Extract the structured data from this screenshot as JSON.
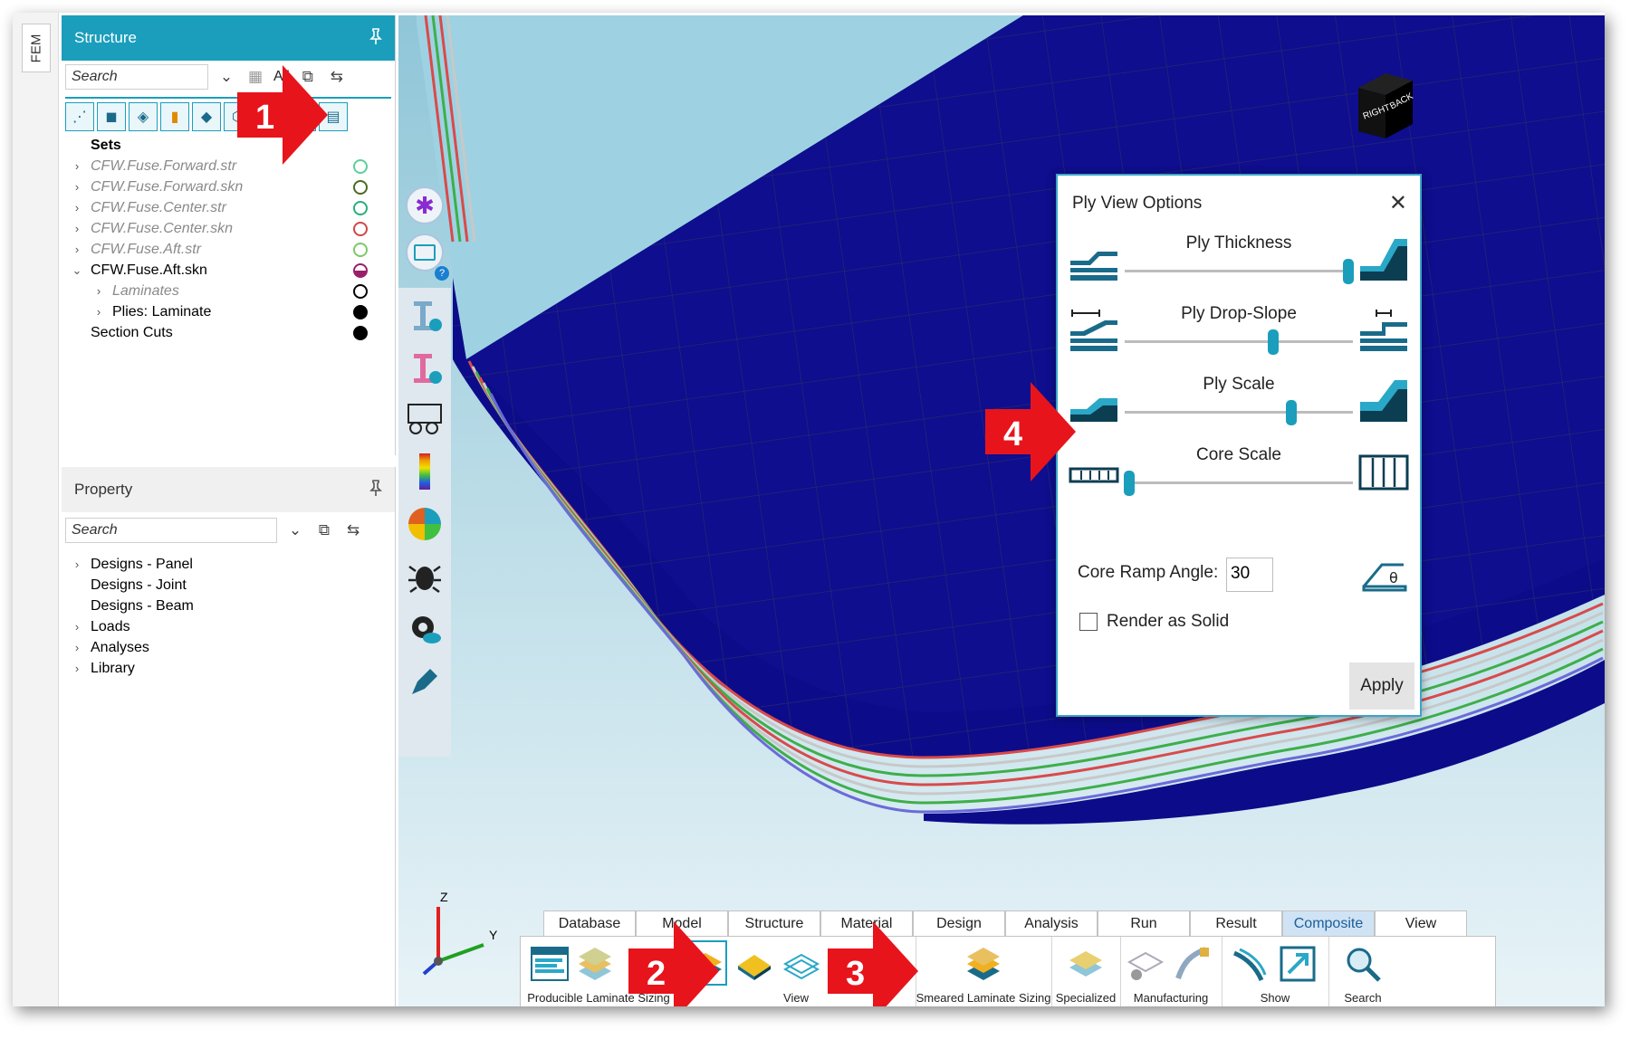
{
  "side_tab": {
    "label": "FEM"
  },
  "structure_panel": {
    "title": "Structure",
    "search_placeholder": "Search",
    "all_label": "All",
    "tree": [
      {
        "label": "Sets",
        "style": "bold",
        "circle": ""
      },
      {
        "label": "CFW.Fuse.Forward.str",
        "style": "dim",
        "circle": "#5ccf9a"
      },
      {
        "label": "CFW.Fuse.Forward.skn",
        "style": "dim",
        "circle": "#4a6b1f"
      },
      {
        "label": "CFW.Fuse.Center.str",
        "style": "dim",
        "circle": "#27b07a"
      },
      {
        "label": "CFW.Fuse.Center.skn",
        "style": "dim",
        "circle": "#d04848"
      },
      {
        "label": "CFW.Fuse.Aft.str",
        "style": "dim",
        "circle": "#7cc968"
      },
      {
        "label": "CFW.Fuse.Aft.skn",
        "style": "normal",
        "circle": "#9a1f6b"
      },
      {
        "label": "Laminates",
        "style": "dim-child",
        "circle": "#000000"
      },
      {
        "label": "Plies: Laminate",
        "style": "child",
        "circle": "#000000"
      },
      {
        "label": "Section Cuts",
        "style": "normal",
        "circle": "#000000"
      }
    ]
  },
  "property_panel": {
    "title": "Property",
    "search_placeholder": "Search",
    "tree": [
      {
        "label": "Designs - Panel",
        "caret": true
      },
      {
        "label": "Designs - Joint",
        "caret": false
      },
      {
        "label": "Designs - Beam",
        "caret": false
      },
      {
        "label": "Loads",
        "caret": true
      },
      {
        "label": "Analyses",
        "caret": true
      },
      {
        "label": "Library",
        "caret": true
      }
    ]
  },
  "viewcube": {
    "right": "RIGHT",
    "back": "BACK"
  },
  "dialog": {
    "title": "Ply View Options",
    "sliders": [
      {
        "label": "Ply Thickness",
        "value": 0.98
      },
      {
        "label": "Ply Drop-Slope",
        "value": 0.65
      },
      {
        "label": "Ply Scale",
        "value": 0.73
      },
      {
        "label": "Core Scale",
        "value": 0.02
      }
    ],
    "core_ramp_label": "Core Ramp Angle:",
    "core_ramp_value": "30",
    "render_solid_label": "Render as Solid",
    "render_solid_checked": false,
    "apply_label": "Apply"
  },
  "menu_tabs": [
    "Database",
    "Model",
    "Structure",
    "Material",
    "Design",
    "Analysis",
    "Run",
    "Result",
    "Composite",
    "View"
  ],
  "active_tab": "Composite",
  "ribbon": {
    "producible": "Producible Laminate Sizing",
    "view": "View",
    "smeared": "Smeared Laminate Sizing",
    "specialized": "Specialized",
    "manufacturing": "Manufacturing",
    "show": "Show",
    "search": "Search"
  },
  "axis": {
    "z": "Z",
    "y": "Y"
  },
  "callouts": [
    "1",
    "2",
    "3",
    "4"
  ],
  "colors": {
    "accent": "#1a9ebc",
    "callout": "#e8141c",
    "viewport": "#0c0c8a",
    "active_tab": "#cfe3f4"
  }
}
